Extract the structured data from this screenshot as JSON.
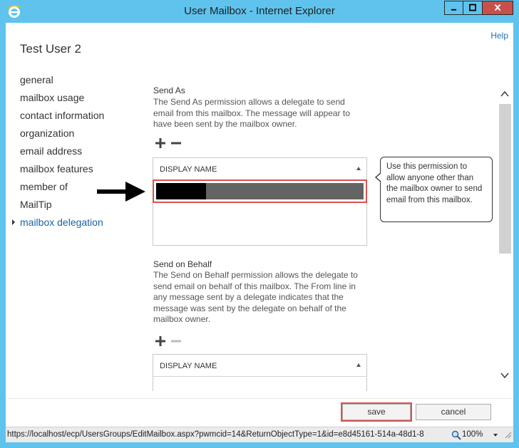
{
  "window": {
    "title": "User Mailbox - Internet Explorer"
  },
  "header": {
    "help": "Help",
    "page_title": "Test User 2"
  },
  "nav": {
    "items": [
      {
        "label": "general"
      },
      {
        "label": "mailbox usage"
      },
      {
        "label": "contact information"
      },
      {
        "label": "organization"
      },
      {
        "label": "email address"
      },
      {
        "label": "mailbox features"
      },
      {
        "label": "member of"
      },
      {
        "label": "MailTip"
      },
      {
        "label": "mailbox delegation"
      }
    ],
    "active": "mailbox delegation"
  },
  "send_as": {
    "title": "Send As",
    "description": "The Send As permission allows a delegate to send email from this mailbox. The message will appear to have been sent by the mailbox owner.",
    "column": "DISPLAY NAME"
  },
  "send_on_behalf": {
    "title": "Send on Behalf",
    "description": "The Send on Behalf permission allows the delegate to send email on behalf of this mailbox. The From line in any message sent by a delegate indicates that the message was sent by the delegate on behalf of the mailbox owner.",
    "column": "DISPLAY NAME"
  },
  "callout": {
    "text": "Use this permission to allow anyone other than the mailbox owner to send email from this mailbox."
  },
  "buttons": {
    "save": "save",
    "cancel": "cancel"
  },
  "status": {
    "url": "https://localhost/ecp/UsersGroups/EditMailbox.aspx?pwmcid=14&ReturnObjectType=1&id=e8d45161-514a-48d1-8",
    "zoom": "100%"
  },
  "colors": {
    "titlebar": "#5fc3ee",
    "link": "#1f70b4",
    "highlight": "#d9534f",
    "close": "#c7504a"
  },
  "icons": [
    "ie-logo-icon",
    "minimize-icon",
    "maximize-icon",
    "close-icon",
    "add-icon",
    "remove-icon",
    "sort-up-icon",
    "arrow-pointer-icon",
    "zoom-icon"
  ]
}
